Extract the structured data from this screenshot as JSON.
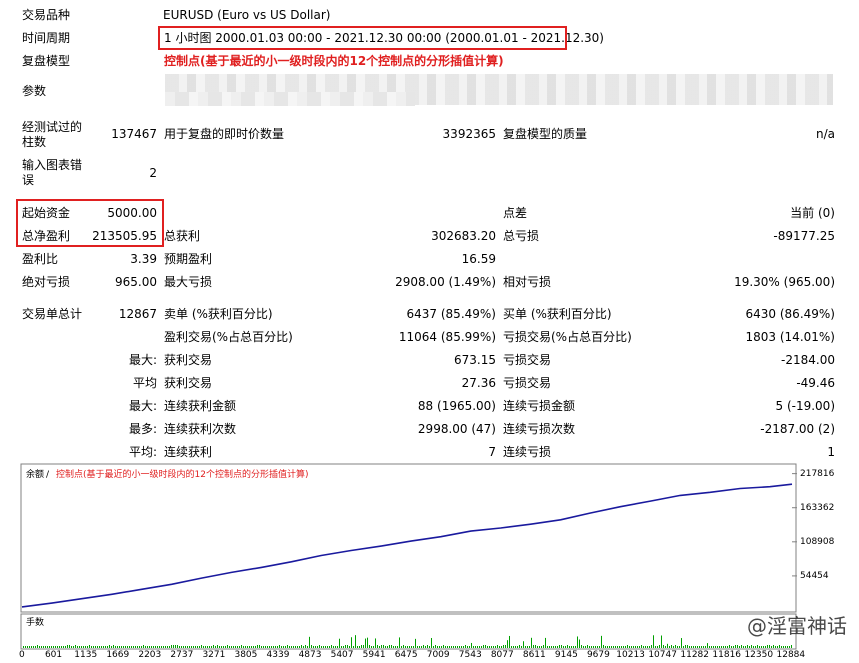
{
  "header": {
    "symbol_label": "交易品种",
    "symbol_value": "EURUSD (Euro vs US Dollar)",
    "period_label": "时间周期",
    "period_value": "1 小时图 2000.01.03 00:00 - 2021.12.30 00:00 (2000.01.01 - 2021.12.30)",
    "model_label": "复盘模型",
    "model_value": "控制点(基于最近的小一级时段内的12个控制点的分形插值计算)",
    "params_label": "参数"
  },
  "info": {
    "bars_label_l1": "经测试过的",
    "bars_label_l2": "柱数",
    "bars_value": "137467",
    "ticks_label": "用于复盘的即时价数量",
    "ticks_value": "3392365",
    "quality_label": "复盘模型的质量",
    "quality_value": "n/a",
    "errors_label_l1": "输入图表错",
    "errors_label_l2": "误",
    "errors_value": "2"
  },
  "stats": {
    "initial_deposit_label": "起始资金",
    "initial_deposit_value": "5000.00",
    "spread_label": "点差",
    "spread_value": "当前 (0)",
    "net_profit_label": "总净盈利",
    "net_profit_value": "213505.95",
    "gross_profit_label": "总获利",
    "gross_profit_value": "302683.20",
    "gross_loss_label": "总亏损",
    "gross_loss_value": "-89177.25",
    "profit_factor_label": "盈利比",
    "profit_factor_value": "3.39",
    "expected_payoff_label": "预期盈利",
    "expected_payoff_value": "16.59",
    "abs_dd_label": "绝对亏损",
    "abs_dd_value": "965.00",
    "max_dd_label": "最大亏损",
    "max_dd_value": "2908.00 (1.49%)",
    "rel_dd_label": "相对亏损",
    "rel_dd_value": "19.30% (965.00)",
    "total_trades_label": "交易单总计",
    "total_trades_value": "12867",
    "short_label": "卖单 (%获利百分比)",
    "short_value": "6437 (85.49%)",
    "long_label": "买单 (%获利百分比)",
    "long_value": "6430 (86.49%)",
    "profit_trades_label": "盈利交易(%占总百分比)",
    "profit_trades_value": "11064 (85.99%)",
    "loss_trades_label": "亏损交易(%占总百分比)",
    "loss_trades_value": "1803 (14.01%)",
    "largest_prefix": "最大:",
    "largest_profit_label": "获利交易",
    "largest_profit_value": "673.15",
    "largest_loss_label": "亏损交易",
    "largest_loss_value": "-2184.00",
    "average_prefix": "平均",
    "avg_profit_label": "获利交易",
    "avg_profit_value": "27.36",
    "avg_loss_label": "亏损交易",
    "avg_loss_value": "-49.46",
    "max_prefix": "最大:",
    "max_cons_wins_money_label": "连续获利金额",
    "max_cons_wins_money_value": "88 (1965.00)",
    "max_cons_loss_money_label": "连续亏损金额",
    "max_cons_loss_money_value": "5 (-19.00)",
    "most_prefix": "最多:",
    "max_cons_profit_label": "连续获利次数",
    "max_cons_profit_value": "2998.00 (47)",
    "max_cons_loss_label": "连续亏损次数",
    "max_cons_loss_value": "-2187.00 (2)",
    "avg_prefix": "平均:",
    "avg_cons_wins_label": "连续获利",
    "avg_cons_wins_value": "7",
    "avg_cons_loss_label": "连续亏损",
    "avg_cons_loss_value": "1"
  },
  "chart_data": {
    "type": "line",
    "legend_balance": "余额",
    "legend_sep": " / ",
    "legend_model": "控制点(基于最近的小一级时段内的12个控制点的分形插值计算)",
    "volume_label": "手数",
    "y_ticks": [
      "217816",
      "163362",
      "108908",
      "54454"
    ],
    "ylim": [
      0,
      230000
    ],
    "x_ticks": [
      "0",
      "601",
      "1135",
      "1669",
      "2203",
      "2737",
      "3271",
      "3805",
      "4339",
      "4873",
      "5407",
      "5941",
      "6475",
      "7009",
      "7543",
      "8077",
      "8611",
      "9145",
      "9679",
      "10213",
      "10747",
      "11282",
      "11816",
      "12350",
      "12884"
    ],
    "x_range": [
      0,
      12867
    ],
    "series": [
      {
        "values": [
          [
            0,
            5000
          ],
          [
            500,
            11000
          ],
          [
            1000,
            18000
          ],
          [
            1500,
            25000
          ],
          [
            2000,
            33000
          ],
          [
            2500,
            41000
          ],
          [
            3000,
            51000
          ],
          [
            3500,
            60000
          ],
          [
            4000,
            68000
          ],
          [
            4500,
            77000
          ],
          [
            5000,
            87000
          ],
          [
            5500,
            95000
          ],
          [
            6000,
            102000
          ],
          [
            6500,
            110000
          ],
          [
            7000,
            117000
          ],
          [
            7500,
            126000
          ],
          [
            8000,
            131000
          ],
          [
            8500,
            137000
          ],
          [
            9000,
            144000
          ],
          [
            9500,
            155000
          ],
          [
            10000,
            165000
          ],
          [
            10500,
            174000
          ],
          [
            11000,
            183000
          ],
          [
            11500,
            188000
          ],
          [
            12000,
            194000
          ],
          [
            12500,
            197000
          ],
          [
            12867,
            201000
          ]
        ],
        "color": "#1a1a9e"
      }
    ],
    "colors": {
      "line": "#1a1a9e",
      "volume": "#00a000",
      "grid": "#dcdcdc",
      "highlight": "#e02020"
    }
  }
}
